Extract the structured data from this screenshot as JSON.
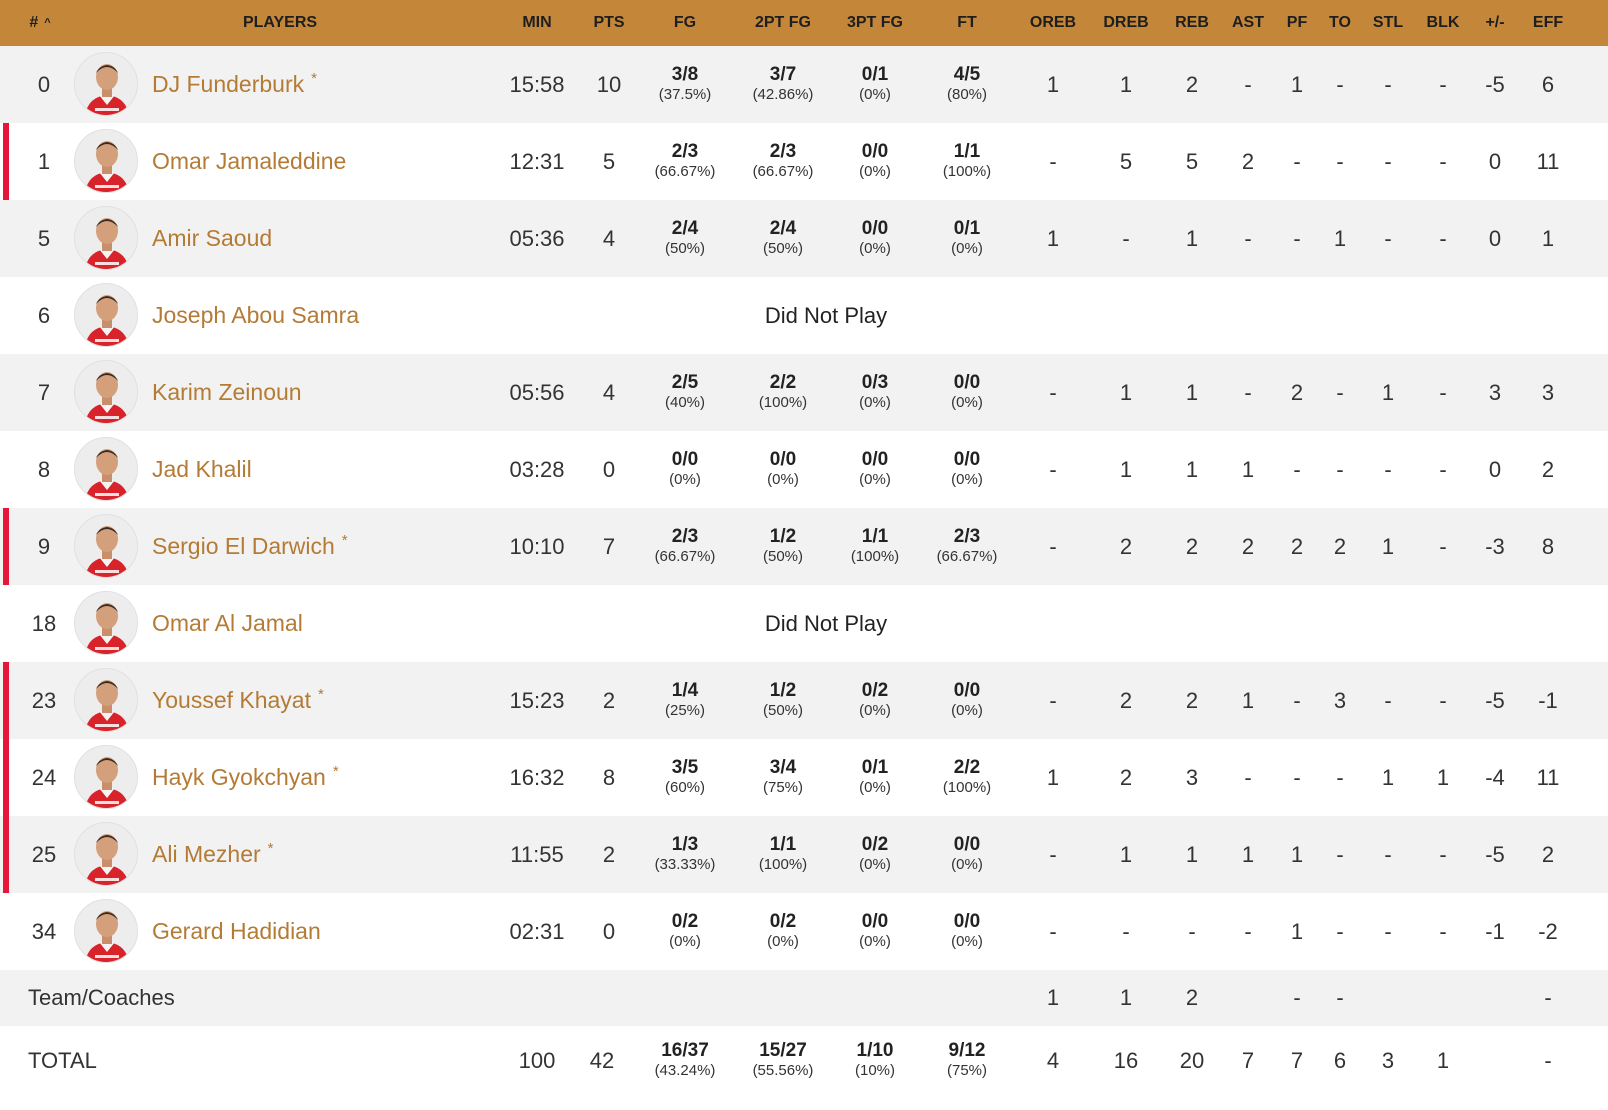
{
  "colors": {
    "header_bg": "#c4873a",
    "player_name": "#b47b35",
    "starter_bar": "#e4163a",
    "row_alt": "#f2f2f2"
  },
  "header": {
    "number": "#",
    "sort_icon": "^",
    "players": "PLAYERS",
    "min": "MIN",
    "pts": "PTS",
    "fg": "FG",
    "fg2": "2PT FG",
    "fg3": "3PT FG",
    "ft": "FT",
    "oreb": "OREB",
    "dreb": "DREB",
    "reb": "REB",
    "ast": "AST",
    "pf": "PF",
    "to": "TO",
    "stl": "STL",
    "blk": "BLK",
    "pm": "+/-",
    "eff": "EFF"
  },
  "players": [
    {
      "num": "0",
      "name": "DJ Funderburk",
      "star": "*",
      "starter": false,
      "dnp": "",
      "min": "15:58",
      "pts": "10",
      "fg": {
        "made": "3/8",
        "pct": "(37.5%)"
      },
      "fg2": {
        "made": "3/7",
        "pct": "(42.86%)"
      },
      "fg3": {
        "made": "0/1",
        "pct": "(0%)"
      },
      "ft": {
        "made": "4/5",
        "pct": "(80%)"
      },
      "oreb": "1",
      "dreb": "1",
      "reb": "2",
      "ast": "-",
      "pf": "1",
      "to": "-",
      "stl": "-",
      "blk": "-",
      "pm": "-5",
      "eff": "6"
    },
    {
      "num": "1",
      "name": "Omar Jamaleddine",
      "star": "",
      "starter": true,
      "dnp": "",
      "min": "12:31",
      "pts": "5",
      "fg": {
        "made": "2/3",
        "pct": "(66.67%)"
      },
      "fg2": {
        "made": "2/3",
        "pct": "(66.67%)"
      },
      "fg3": {
        "made": "0/0",
        "pct": "(0%)"
      },
      "ft": {
        "made": "1/1",
        "pct": "(100%)"
      },
      "oreb": "-",
      "dreb": "5",
      "reb": "5",
      "ast": "2",
      "pf": "-",
      "to": "-",
      "stl": "-",
      "blk": "-",
      "pm": "0",
      "eff": "11"
    },
    {
      "num": "5",
      "name": "Amir Saoud",
      "star": "",
      "starter": false,
      "dnp": "",
      "min": "05:36",
      "pts": "4",
      "fg": {
        "made": "2/4",
        "pct": "(50%)"
      },
      "fg2": {
        "made": "2/4",
        "pct": "(50%)"
      },
      "fg3": {
        "made": "0/0",
        "pct": "(0%)"
      },
      "ft": {
        "made": "0/1",
        "pct": "(0%)"
      },
      "oreb": "1",
      "dreb": "-",
      "reb": "1",
      "ast": "-",
      "pf": "-",
      "to": "1",
      "stl": "-",
      "blk": "-",
      "pm": "0",
      "eff": "1"
    },
    {
      "num": "6",
      "name": "Joseph Abou Samra",
      "star": "",
      "starter": false,
      "dnp": "Did Not Play"
    },
    {
      "num": "7",
      "name": "Karim Zeinoun",
      "star": "",
      "starter": false,
      "dnp": "",
      "min": "05:56",
      "pts": "4",
      "fg": {
        "made": "2/5",
        "pct": "(40%)"
      },
      "fg2": {
        "made": "2/2",
        "pct": "(100%)"
      },
      "fg3": {
        "made": "0/3",
        "pct": "(0%)"
      },
      "ft": {
        "made": "0/0",
        "pct": "(0%)"
      },
      "oreb": "-",
      "dreb": "1",
      "reb": "1",
      "ast": "-",
      "pf": "2",
      "to": "-",
      "stl": "1",
      "blk": "-",
      "pm": "3",
      "eff": "3"
    },
    {
      "num": "8",
      "name": "Jad Khalil",
      "star": "",
      "starter": false,
      "dnp": "",
      "min": "03:28",
      "pts": "0",
      "fg": {
        "made": "0/0",
        "pct": "(0%)"
      },
      "fg2": {
        "made": "0/0",
        "pct": "(0%)"
      },
      "fg3": {
        "made": "0/0",
        "pct": "(0%)"
      },
      "ft": {
        "made": "0/0",
        "pct": "(0%)"
      },
      "oreb": "-",
      "dreb": "1",
      "reb": "1",
      "ast": "1",
      "pf": "-",
      "to": "-",
      "stl": "-",
      "blk": "-",
      "pm": "0",
      "eff": "2"
    },
    {
      "num": "9",
      "name": "Sergio El Darwich",
      "star": "*",
      "starter": true,
      "dnp": "",
      "min": "10:10",
      "pts": "7",
      "fg": {
        "made": "2/3",
        "pct": "(66.67%)"
      },
      "fg2": {
        "made": "1/2",
        "pct": "(50%)"
      },
      "fg3": {
        "made": "1/1",
        "pct": "(100%)"
      },
      "ft": {
        "made": "2/3",
        "pct": "(66.67%)"
      },
      "oreb": "-",
      "dreb": "2",
      "reb": "2",
      "ast": "2",
      "pf": "2",
      "to": "2",
      "stl": "1",
      "blk": "-",
      "pm": "-3",
      "eff": "8"
    },
    {
      "num": "18",
      "name": "Omar Al Jamal",
      "star": "",
      "starter": false,
      "dnp": "Did Not Play"
    },
    {
      "num": "23",
      "name": "Youssef Khayat",
      "star": "*",
      "starter": true,
      "dnp": "",
      "min": "15:23",
      "pts": "2",
      "fg": {
        "made": "1/4",
        "pct": "(25%)"
      },
      "fg2": {
        "made": "1/2",
        "pct": "(50%)"
      },
      "fg3": {
        "made": "0/2",
        "pct": "(0%)"
      },
      "ft": {
        "made": "0/0",
        "pct": "(0%)"
      },
      "oreb": "-",
      "dreb": "2",
      "reb": "2",
      "ast": "1",
      "pf": "-",
      "to": "3",
      "stl": "-",
      "blk": "-",
      "pm": "-5",
      "eff": "-1"
    },
    {
      "num": "24",
      "name": "Hayk Gyokchyan",
      "star": "*",
      "starter": true,
      "dnp": "",
      "min": "16:32",
      "pts": "8",
      "fg": {
        "made": "3/5",
        "pct": "(60%)"
      },
      "fg2": {
        "made": "3/4",
        "pct": "(75%)"
      },
      "fg3": {
        "made": "0/1",
        "pct": "(0%)"
      },
      "ft": {
        "made": "2/2",
        "pct": "(100%)"
      },
      "oreb": "1",
      "dreb": "2",
      "reb": "3",
      "ast": "-",
      "pf": "-",
      "to": "-",
      "stl": "1",
      "blk": "1",
      "pm": "-4",
      "eff": "11"
    },
    {
      "num": "25",
      "name": "Ali Mezher",
      "star": "*",
      "starter": true,
      "dnp": "",
      "min": "11:55",
      "pts": "2",
      "fg": {
        "made": "1/3",
        "pct": "(33.33%)"
      },
      "fg2": {
        "made": "1/1",
        "pct": "(100%)"
      },
      "fg3": {
        "made": "0/2",
        "pct": "(0%)"
      },
      "ft": {
        "made": "0/0",
        "pct": "(0%)"
      },
      "oreb": "-",
      "dreb": "1",
      "reb": "1",
      "ast": "1",
      "pf": "1",
      "to": "-",
      "stl": "-",
      "blk": "-",
      "pm": "-5",
      "eff": "2"
    },
    {
      "num": "34",
      "name": "Gerard Hadidian",
      "star": "",
      "starter": false,
      "dnp": "",
      "min": "02:31",
      "pts": "0",
      "fg": {
        "made": "0/2",
        "pct": "(0%)"
      },
      "fg2": {
        "made": "0/2",
        "pct": "(0%)"
      },
      "fg3": {
        "made": "0/0",
        "pct": "(0%)"
      },
      "ft": {
        "made": "0/0",
        "pct": "(0%)"
      },
      "oreb": "-",
      "dreb": "-",
      "reb": "-",
      "ast": "-",
      "pf": "1",
      "to": "-",
      "stl": "-",
      "blk": "-",
      "pm": "-1",
      "eff": "-2"
    }
  ],
  "team_coaches": {
    "label": "Team/Coaches",
    "oreb": "1",
    "dreb": "1",
    "reb": "2",
    "pf": "-",
    "to": "-",
    "eff": "-"
  },
  "total": {
    "label": "TOTAL",
    "min": "100",
    "pts": "42",
    "fg": {
      "made": "16/37",
      "pct": "(43.24%)"
    },
    "fg2": {
      "made": "15/27",
      "pct": "(55.56%)"
    },
    "fg3": {
      "made": "1/10",
      "pct": "(10%)"
    },
    "ft": {
      "made": "9/12",
      "pct": "(75%)"
    },
    "oreb": "4",
    "dreb": "16",
    "reb": "20",
    "ast": "7",
    "pf": "7",
    "to": "6",
    "stl": "3",
    "blk": "1",
    "pm": "",
    "eff": "-"
  }
}
